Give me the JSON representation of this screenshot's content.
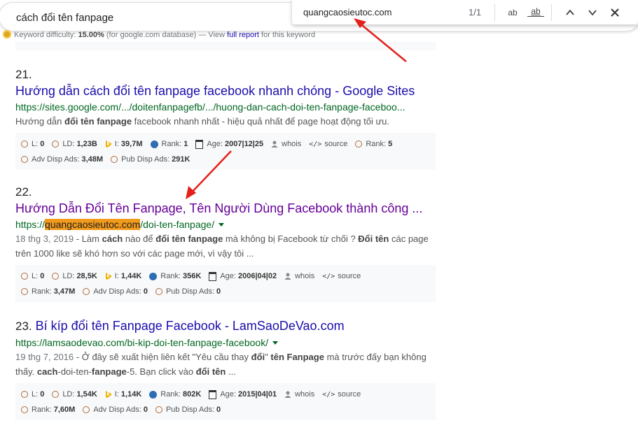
{
  "search": {
    "query": "cách đổi tên fanpage"
  },
  "keyword_difficulty": {
    "label": "Keyword difficulty:",
    "value": "15.00%",
    "note": "(for google.com database) — View",
    "report_link": "full report",
    "suffix": "for this keyword"
  },
  "find_bar": {
    "query": "quangcaosieutoc.com",
    "count": "1/1",
    "match_case": "ab",
    "whole_word": "ab"
  },
  "results": [
    {
      "number": "21.",
      "title": "Hướng dẫn cách đổi tên fanpage facebook nhanh chóng - Google Sites",
      "url": "https://sites.google.com/.../doitenfanpagefb/.../huong-dan-cach-doi-ten-fanpage-faceboo...",
      "snippet_pre": "Hướng dẫn ",
      "snippet_bold1": "đổi tên fanpage",
      "snippet_post": " facebook nhanh nhất - hiệu quả nhất để page hoạt động tối ưu.",
      "metrics": {
        "l": "0",
        "ld": "1,23B",
        "i": "39,7M",
        "rank": "1",
        "age": "2007|12|25",
        "whois": "whois",
        "source": "source",
        "rank2": "5",
        "adv": "3,48M",
        "pub": "291K"
      }
    },
    {
      "number": "22.",
      "title": "Hướng Dẫn Đổi Tên Fanpage, Tên Người Dùng Facebook thành công ...",
      "url_prefix": "https://",
      "url_highlight": "quangcaosieutoc.com",
      "url_suffix": "/doi-ten-fanpage/",
      "snippet_date": "18 thg 3, 2019",
      "snippet_l1a": " - Làm ",
      "snippet_l1b": "cách",
      "snippet_l1c": " nào để ",
      "snippet_l1d": "đổi tên fanpage",
      "snippet_l1e": " mà không bị Facebook từ chối ? ",
      "snippet_l1f": "Đổi tên",
      "snippet_l1g": " các page",
      "snippet_l2": "trên 1000 like sẽ khó hơn so với các page mới, vì vậy tôi ...",
      "metrics": {
        "l": "0",
        "ld": "28,5K",
        "i": "1,44K",
        "rank": "356K",
        "age": "2006|04|02",
        "whois": "whois",
        "source": "source",
        "rank2": "3,47M",
        "adv": "0",
        "pub": "0"
      }
    },
    {
      "number": "23.",
      "title": "Bí kíp đổi tên Fanpage Facebook - LamSaoDeVao.com",
      "url": "https://lamsaodevao.com/bi-kip-doi-ten-fanpage-facebook/",
      "snippet_date": "19 thg 7, 2016",
      "snippet_l1a": " - Ở đây sẽ xuất hiện liên kết \"Yêu cầu thay ",
      "snippet_l1b": "đổi",
      "snippet_l1c": "\" ",
      "snippet_l1d": "tên Fanpage",
      "snippet_l1e": " mà trước đấy bạn không",
      "snippet_l2a": "thấy. ",
      "snippet_l2b": "cach",
      "snippet_l2c": "-doi-ten-",
      "snippet_l2d": "fanpage",
      "snippet_l2e": "-5. Bạn click vào ",
      "snippet_l2f": "đổi tên",
      "snippet_l2g": " ...",
      "metrics": {
        "l": "0",
        "ld": "1,54K",
        "i": "1,14K",
        "rank": "802K",
        "age": "2015|04|01",
        "whois": "whois",
        "source": "source",
        "rank2": "7,60M",
        "adv": "0",
        "pub": "0"
      }
    }
  ],
  "metric_labels": {
    "l": "L:",
    "ld": "LD:",
    "i": "I:",
    "rank": "Rank:",
    "age": "Age:",
    "adv": "Adv Disp Ads:",
    "pub": "Pub Disp Ads:"
  },
  "colors": {
    "link": "#1a0dab",
    "visited": "#660099",
    "url": "#006621",
    "highlight": "#f29a1b",
    "arrow": "#e3201b"
  }
}
